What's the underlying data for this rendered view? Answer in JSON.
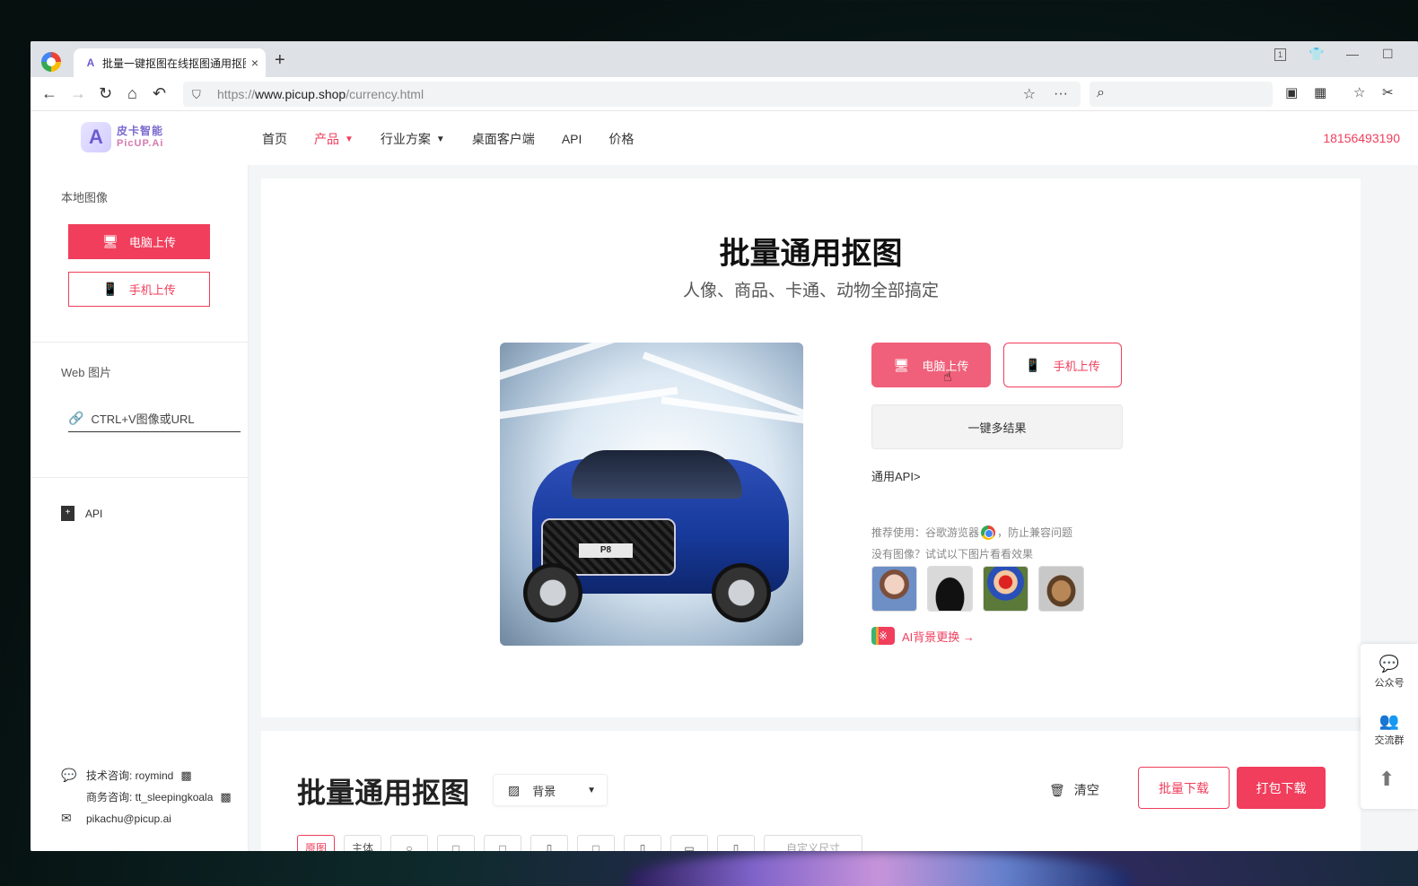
{
  "browser": {
    "tab_title": "批量一键抠图在线抠图通用抠图",
    "tab_close": "×",
    "new_tab": "+",
    "window_badge": "1",
    "url_scheme": "https://",
    "url_host": "www.picup.shop",
    "url_path": "/currency.html"
  },
  "site": {
    "logo_mark": "A",
    "logo_cn": "皮卡智能",
    "logo_en": "PicUP.Ai",
    "nav": [
      {
        "label": "首页"
      },
      {
        "label": "产品"
      },
      {
        "label": "行业方案"
      },
      {
        "label": "桌面客户端"
      },
      {
        "label": "API"
      },
      {
        "label": "价格"
      }
    ],
    "phone": "18156493190",
    "active_color": "#f03e5c"
  },
  "sidebar": {
    "local_label": "本地图像",
    "pc_upload": "电脑上传",
    "mobile_upload": "手机上传",
    "web_label": "Web 图片",
    "url_input": "CTRL+V图像或URL",
    "api": "API",
    "tech_contact": "技术咨询: roymind",
    "biz_contact": "商务咨询: tt_sleepingkoala",
    "email": "pikachu@picup.ai"
  },
  "hero": {
    "title": "批量通用抠图",
    "subtitle": "人像、商品、卡通、动物全部搞定",
    "plate_text": "P8",
    "pc_upload": "电脑上传",
    "mobile_upload": "手机上传",
    "multi_result": "一键多结果",
    "api_link": "通用API>",
    "recommend_prefix": "推荐使用：谷歌游览器",
    "recommend_suffix": "，防止兼容问题",
    "sample_hint": "没有图像？试试以下图片看看效果",
    "ai_icon_text": "※",
    "ai_bg_link": "AI背景更换 →"
  },
  "workspace": {
    "title": "批量通用抠图",
    "bg_select": "背景",
    "clear": "清空",
    "batch_download": "批量下载",
    "pack_download": "打包下载",
    "chips": [
      "原图",
      "主体",
      "○",
      "□",
      "□",
      "▯",
      "□",
      "▯",
      "▭",
      "▯",
      "自定义尺寸"
    ]
  },
  "floater": {
    "wechat": "公众号",
    "group": "交流群",
    "top": "⬆"
  }
}
